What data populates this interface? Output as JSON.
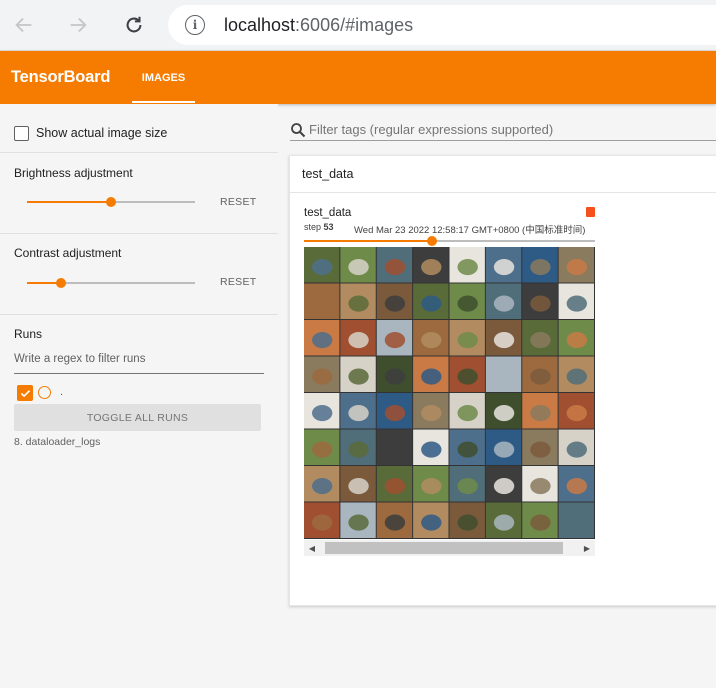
{
  "browser": {
    "url_host": "localhost",
    "url_rest": ":6006/#images"
  },
  "header": {
    "title": "TensorBoard",
    "tab_images": "IMAGES"
  },
  "sidebar": {
    "show_actual_size": "Show actual image size",
    "brightness": {
      "label": "Brightness adjustment",
      "reset": "RESET",
      "value": 0.5
    },
    "contrast": {
      "label": "Contrast adjustment",
      "reset": "RESET",
      "value": 0.2
    },
    "runs": {
      "title": "Runs",
      "filter_placeholder": "Write a regex to filter runs",
      "run_dot": ".",
      "toggle_all": "TOGGLE ALL RUNS",
      "run_name": "8. dataloader_logs"
    }
  },
  "main": {
    "filter_placeholder": "Filter tags (regular expressions supported)",
    "card": {
      "title": "test_data",
      "image_tag": "test_data",
      "step_label": "step",
      "step_value": "53",
      "timestamp": "Wed Mar 23 2022 12:58:17 GMT+0800 (中国标准时间)",
      "step_progress": 0.44
    }
  },
  "colors": {
    "accent": "#f57c00",
    "tile_palette": [
      "#5a6b3a",
      "#8a7a5e",
      "#b28c60",
      "#4e6f8c",
      "#a9b6c0",
      "#3d3d3d",
      "#c97a45",
      "#6f8b4a",
      "#d7d2c8",
      "#7b5a3c",
      "#2e5a86",
      "#9c6a3e",
      "#e8e4de",
      "#a05030",
      "#506d7a",
      "#3f4f2e"
    ]
  },
  "icons": [
    "back-arrow-icon",
    "forward-arrow-icon",
    "reload-icon",
    "info-icon",
    "search-icon",
    "checkmark-icon"
  ]
}
